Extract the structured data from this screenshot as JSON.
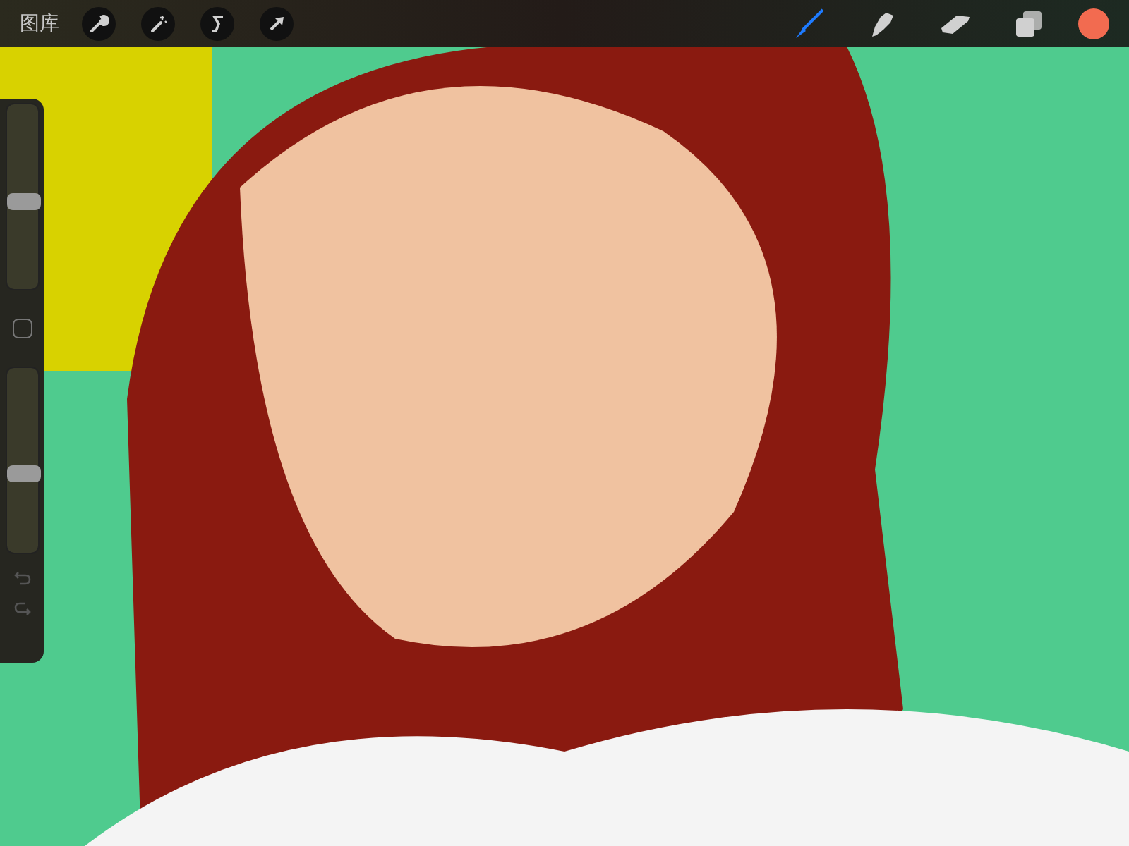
{
  "toolbar": {
    "gallery_label": "图库",
    "left_tools": [
      {
        "kind": "wrench",
        "selected": false
      },
      {
        "kind": "wand",
        "selected": false
      },
      {
        "kind": "select",
        "selected": false
      },
      {
        "kind": "move",
        "selected": false
      }
    ],
    "right_tools": [
      {
        "kind": "brush",
        "selected": true
      },
      {
        "kind": "smudge",
        "selected": false
      },
      {
        "kind": "eraser",
        "selected": false
      },
      {
        "kind": "layers",
        "selected": false
      }
    ],
    "color": "#f26b50"
  },
  "sidebar": {
    "size_slider": {
      "level": 0.47
    },
    "opacity_slider": {
      "level": 0.43
    }
  }
}
